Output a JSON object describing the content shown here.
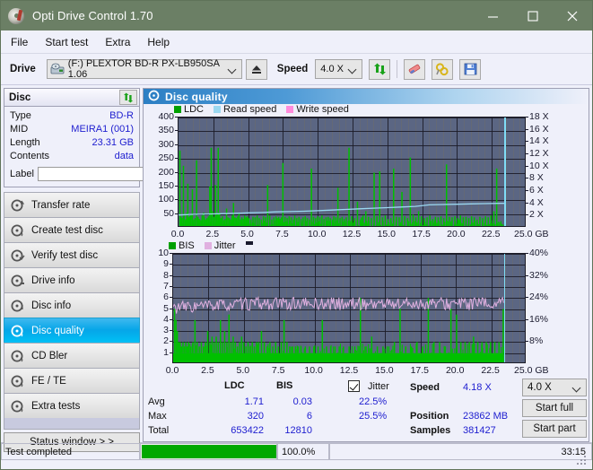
{
  "window": {
    "title": "Opti Drive Control 1.70",
    "icon": "disc-icon",
    "minimize": "minimize-icon",
    "maximize": "maximize-icon",
    "close": "close-icon"
  },
  "menu": {
    "items": [
      "File",
      "Start test",
      "Extra",
      "Help"
    ]
  },
  "toolbar": {
    "drive_label": "Drive",
    "drive_value": "(F:)   PLEXTOR BD-R  PX-LB950SA 1.06",
    "eject_icon": "eject-icon",
    "speed_label": "Speed",
    "speed_value": "4.0 X",
    "refresh_icon": "refresh-icon",
    "eraser_icon": "eraser-icon",
    "tools_icon": "tools-icon",
    "save_icon": "save-icon"
  },
  "disc_panel": {
    "title": "Disc",
    "refresh_icon": "refresh-icon",
    "rows": [
      {
        "key": "Type",
        "value": "BD-R"
      },
      {
        "key": "MID",
        "value": "MEIRA1 (001)"
      },
      {
        "key": "Length",
        "value": "23.31 GB"
      },
      {
        "key": "Contents",
        "value": "data"
      }
    ],
    "label_key": "Label",
    "label_value": "",
    "disc_button_icon": "disc-icon"
  },
  "nav": {
    "items": [
      {
        "label": "Transfer rate",
        "icon": "disc-rate-icon",
        "selected": false
      },
      {
        "label": "Create test disc",
        "icon": "disc-create-icon",
        "selected": false
      },
      {
        "label": "Verify test disc",
        "icon": "disc-verify-icon",
        "selected": false
      },
      {
        "label": "Drive info",
        "icon": "drive-info-icon",
        "selected": false
      },
      {
        "label": "Disc info",
        "icon": "disc-info-icon",
        "selected": false
      },
      {
        "label": "Disc quality",
        "icon": "disc-quality-icon",
        "selected": true
      },
      {
        "label": "CD Bler",
        "icon": "disc-bler-icon",
        "selected": false
      },
      {
        "label": "FE / TE",
        "icon": "disc-fete-icon",
        "selected": false
      },
      {
        "label": "Extra tests",
        "icon": "disc-extra-icon",
        "selected": false
      }
    ],
    "status_window": "Status window > >"
  },
  "content": {
    "header": "Disc quality",
    "header_icon": "disc-quality-icon"
  },
  "stats": {
    "col_ldc": "LDC",
    "col_bis": "BIS",
    "row_avg": "Avg",
    "row_max": "Max",
    "row_total": "Total",
    "ldc_avg": "1.71",
    "ldc_max": "320",
    "ldc_total": "653422",
    "bis_avg": "0.03",
    "bis_max": "6",
    "bis_total": "12810",
    "jitter_label": "Jitter",
    "jitter_checked": true,
    "jitter_avg": "22.5%",
    "jitter_max": "25.5%",
    "speed_label": "Speed",
    "speed_value": "4.18 X",
    "position_label": "Position",
    "position_value": "23862 MB",
    "samples_label": "Samples",
    "samples_value": "381427",
    "speed_select": "4.0 X",
    "start_full": "Start full",
    "start_part": "Start part"
  },
  "statusbar": {
    "message": "Test completed",
    "percent": "100.0%",
    "percent_value": 100,
    "elapsed": "33:15"
  },
  "colors": {
    "titlebar": "#6b7f65",
    "accent": "#00a8e8",
    "plot_bg": "#5b6683",
    "ldc": "#00c000",
    "bis": "#00c000",
    "read_speed": "#9bd8f0",
    "write_speed": "#ff8cdc",
    "jitter": "#e0b0e0",
    "progress": "#00a800",
    "value_text": "#2020d0"
  },
  "chart_data": [
    {
      "type": "line",
      "name": "ldc-chart",
      "title": "",
      "xlabel": "GB",
      "ylabel": "",
      "xlim": [
        0,
        25
      ],
      "ylim": [
        0,
        400
      ],
      "y2lim": [
        0,
        18
      ],
      "grid": true,
      "legend_position": "top-left",
      "legend": [
        {
          "label": "LDC",
          "color": "#00a000"
        },
        {
          "label": "Read speed",
          "color": "#9bd8f0"
        },
        {
          "label": "Write speed",
          "color": "#ff8cdc"
        }
      ],
      "xticks": [
        0.0,
        2.5,
        5.0,
        7.5,
        10.0,
        12.5,
        15.0,
        17.5,
        20.0,
        22.5,
        25.0
      ],
      "xticklabels": [
        "0.0",
        "2.5",
        "5.0",
        "7.5",
        "10.0",
        "12.5",
        "15.0",
        "17.5",
        "20.0",
        "22.5",
        "25.0 GB"
      ],
      "yticks": [
        50,
        100,
        150,
        200,
        250,
        300,
        350,
        400
      ],
      "yticklabels": [
        "50",
        "100",
        "150",
        "200",
        "250",
        "300",
        "350",
        "400"
      ],
      "y2ticks": [
        2,
        4,
        6,
        8,
        10,
        12,
        14,
        16,
        18
      ],
      "y2ticklabels": [
        "2 X",
        "4 X",
        "6 X",
        "8 X",
        "10 X",
        "12 X",
        "14 X",
        "16 X",
        "18 X"
      ],
      "cursor_x": 23.4,
      "data_end_x": 23.4,
      "series": [
        {
          "name": "LDC",
          "type": "bar",
          "color": "#00c000",
          "x": [
            0.05,
            0.12,
            0.2,
            0.3,
            0.35,
            0.45,
            0.55,
            0.62,
            0.7,
            0.78,
            0.85,
            0.95,
            1.05,
            1.15,
            1.25,
            1.35,
            1.45,
            1.55,
            1.65,
            1.75,
            1.8,
            1.9,
            2.0,
            2.1,
            2.2,
            2.3,
            2.4,
            2.5,
            2.6,
            2.7,
            2.8,
            2.9,
            3.0,
            3.1,
            3.2,
            3.3,
            3.4,
            3.5,
            3.6,
            3.7,
            3.8,
            3.9,
            4.0,
            4.1,
            4.2,
            4.3,
            4.4,
            4.5,
            4.6,
            4.7,
            4.8,
            4.9,
            5.0,
            5.15,
            5.3,
            5.45,
            5.6,
            5.75,
            5.9,
            6.05,
            6.2,
            6.35,
            6.5,
            6.65,
            6.8,
            6.95,
            7.05,
            7.15,
            7.25,
            7.35,
            7.45,
            7.6,
            7.75,
            7.9,
            8.05,
            8.2,
            8.3,
            8.45,
            8.6,
            8.75,
            8.9,
            9.05,
            9.2,
            9.35,
            9.5,
            9.65,
            9.8,
            9.95,
            10.1,
            10.25,
            10.4,
            10.55,
            10.7,
            10.85,
            11.0,
            11.1,
            11.25,
            11.4,
            11.55,
            11.7,
            11.85,
            12.0,
            12.2,
            12.4,
            12.6,
            12.8,
            13.0,
            13.1,
            13.2,
            13.4,
            13.6,
            13.8,
            14.0,
            14.2,
            14.4,
            14.6,
            14.8,
            15.0,
            15.2,
            15.4,
            15.6,
            15.8,
            16.0,
            16.2,
            16.4,
            16.6,
            16.8,
            17.0,
            17.2,
            17.4,
            17.6,
            17.8,
            18.0,
            18.2,
            18.4,
            18.6,
            18.8,
            19.0,
            19.2,
            19.4,
            19.6,
            19.8,
            20.0,
            20.1,
            20.2,
            20.4,
            20.6,
            20.8,
            21.0,
            21.2,
            21.4,
            21.6,
            21.8,
            22.0,
            22.2,
            22.4,
            22.6,
            22.8,
            23.0,
            23.2,
            23.35
          ],
          "values": [
            280,
            40,
            35,
            225,
            45,
            30,
            55,
            160,
            38,
            42,
            50,
            140,
            30,
            35,
            245,
            40,
            32,
            28,
            45,
            55,
            38,
            30,
            35,
            42,
            150,
            290,
            60,
            40,
            155,
            48,
            290,
            55,
            35,
            42,
            28,
            32,
            70,
            38,
            35,
            30,
            45,
            90,
            38,
            35,
            42,
            55,
            30,
            38,
            32,
            45,
            38,
            42,
            35,
            30,
            40,
            38,
            45,
            35,
            30,
            42,
            38,
            155,
            45,
            30,
            38,
            42,
            35,
            40,
            32,
            38,
            235,
            40,
            35,
            42,
            38,
            30,
            45,
            35,
            40,
            32,
            38,
            42,
            35,
            30,
            215,
            40,
            35,
            42,
            38,
            45,
            32,
            38,
            40,
            35,
            30,
            42,
            38,
            145,
            35,
            40,
            32,
            38,
            290,
            42,
            35,
            95,
            30,
            38,
            45,
            60,
            40,
            35,
            200,
            42,
            205,
            38,
            45,
            32,
            35,
            215,
            40,
            38,
            130,
            42,
            35,
            255,
            48,
            38,
            60,
            42,
            35,
            38,
            45,
            32,
            40,
            38,
            42,
            35,
            230,
            40,
            38,
            42,
            35,
            30,
            45,
            38,
            40,
            35,
            42,
            38,
            30,
            40,
            35,
            42,
            38,
            45,
            60,
            215
          ]
        },
        {
          "name": "Read speed",
          "type": "line",
          "color": "#9bd8f0",
          "x": [
            0.0,
            1.0,
            2.0,
            3.0,
            4.0,
            5.0,
            6.0,
            7.0,
            8.0,
            9.0,
            10.0,
            11.0,
            12.0,
            13.0,
            14.0,
            15.0,
            16.0,
            17.0,
            18.0,
            19.0,
            20.0,
            21.0,
            22.0,
            23.0,
            23.4
          ],
          "values": [
            2.1,
            2.2,
            2.25,
            2.3,
            2.35,
            2.45,
            2.5,
            2.6,
            2.65,
            2.7,
            2.8,
            2.9,
            3.0,
            3.1,
            3.2,
            3.3,
            3.4,
            3.5,
            3.75,
            3.8,
            3.85,
            3.9,
            3.95,
            4.0,
            4.0
          ],
          "axis": "y2"
        }
      ]
    },
    {
      "type": "line",
      "name": "bis-jitter-chart",
      "title": "",
      "xlabel": "GB",
      "ylabel": "",
      "xlim": [
        0,
        25
      ],
      "ylim": [
        0,
        10
      ],
      "y2lim": [
        0,
        40
      ],
      "grid": true,
      "legend_position": "top-left",
      "legend": [
        {
          "label": "BIS",
          "color": "#00a000"
        },
        {
          "label": "Jitter",
          "color": "#e0b0e0"
        }
      ],
      "xticks": [
        0.0,
        2.5,
        5.0,
        7.5,
        10.0,
        12.5,
        15.0,
        17.5,
        20.0,
        22.5,
        25.0
      ],
      "xticklabels": [
        "0.0",
        "2.5",
        "5.0",
        "7.5",
        "10.0",
        "12.5",
        "15.0",
        "17.5",
        "20.0",
        "22.5",
        "25.0 GB"
      ],
      "yticks": [
        1,
        2,
        3,
        4,
        5,
        6,
        7,
        8,
        9,
        10
      ],
      "yticklabels": [
        "1",
        "2",
        "3",
        "4",
        "5",
        "6",
        "7",
        "8",
        "9",
        "10"
      ],
      "y2ticks": [
        8,
        16,
        24,
        32,
        40
      ],
      "y2ticklabels": [
        "8%",
        "16%",
        "24%",
        "32%",
        "40%"
      ],
      "cursor_x": 23.4,
      "data_end_x": 23.4,
      "series": [
        {
          "name": "BIS",
          "type": "bar",
          "color": "#00c000",
          "baseline": 1,
          "x": [
            0.05,
            0.15,
            0.25,
            0.35,
            0.45,
            0.55,
            0.65,
            0.75,
            0.85,
            0.95,
            1.05,
            1.2,
            1.35,
            1.5,
            1.65,
            1.8,
            1.95,
            2.1,
            2.25,
            2.4,
            2.55,
            2.7,
            2.85,
            3.0,
            3.15,
            3.3,
            3.45,
            3.6,
            3.75,
            3.9,
            4.05,
            4.2,
            4.35,
            4.5,
            4.65,
            4.8,
            4.95,
            5.1,
            5.25,
            5.4,
            5.55,
            5.7,
            5.85,
            6.0,
            6.2,
            6.4,
            6.6,
            6.8,
            7.0,
            7.2,
            7.4,
            7.6,
            7.8,
            8.0,
            8.2,
            8.4,
            8.6,
            8.8,
            9.0,
            9.3,
            9.6,
            9.9,
            10.2,
            10.5,
            10.8,
            11.1,
            11.4,
            11.7,
            12.0,
            12.4,
            12.8,
            13.2,
            13.6,
            14.0,
            14.4,
            14.8,
            15.2,
            15.6,
            16.0,
            16.4,
            16.8,
            17.2,
            17.6,
            18.0,
            18.4,
            18.8,
            19.2,
            19.6,
            20.0,
            20.3,
            20.6,
            20.9,
            21.2,
            21.5,
            21.8,
            22.1,
            22.4,
            22.7,
            23.0,
            23.3
          ],
          "values": [
            5,
            4,
            3,
            2,
            2,
            1.6,
            2,
            1.6,
            2,
            1.6,
            2,
            1.6,
            2,
            4,
            2,
            1.6,
            2,
            1.6,
            2,
            3,
            2,
            2.5,
            2,
            2.5,
            2,
            4,
            2,
            3,
            2,
            4.5,
            2,
            2.5,
            2,
            1.6,
            2,
            2.5,
            2,
            1.6,
            2,
            1.6,
            2,
            1.6,
            2,
            2,
            3,
            2,
            1.6,
            2,
            1.6,
            2,
            1.6,
            2,
            4,
            2,
            1.6,
            1.6,
            1.6,
            1.6,
            1.6,
            1.6,
            1.6,
            1.6,
            1.6,
            4,
            1.6,
            1.6,
            1.6,
            1.6,
            1.6,
            1.6,
            1.6,
            6,
            1.6,
            2.5,
            1.6,
            1.6,
            1.6,
            2,
            5,
            1.6,
            1.6,
            2,
            1.6,
            6,
            2,
            2,
            1.6,
            5,
            4.5,
            2,
            2,
            2,
            2.5,
            2,
            2,
            2,
            2,
            2,
            2,
            5
          ]
        },
        {
          "name": "Jitter",
          "type": "line",
          "color": "#e0b0e0",
          "axis": "y2",
          "avg": 22.5,
          "max": 25.5,
          "range_low": 18,
          "range_high": 25.5
        }
      ]
    }
  ]
}
